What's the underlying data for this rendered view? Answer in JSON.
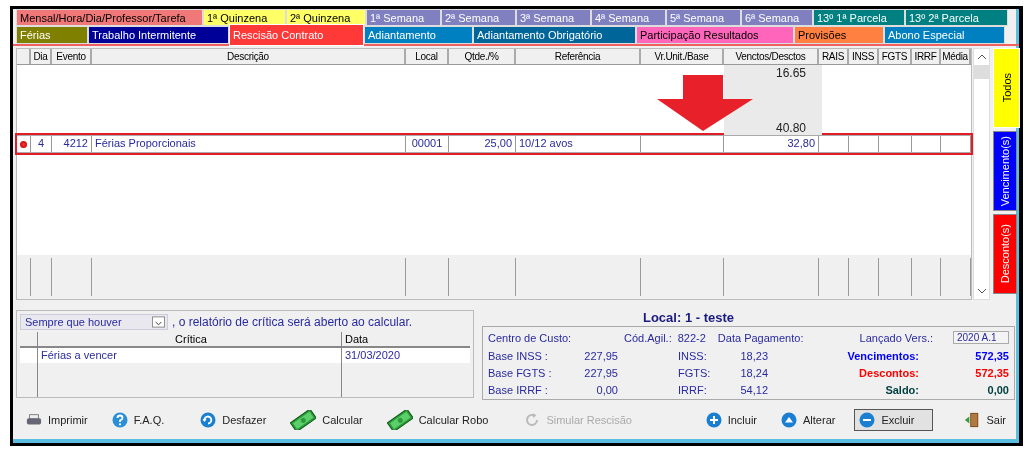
{
  "tabs_row_1": [
    {
      "label": "Mensal/Hora/Dia/Professor/Tarefa",
      "color": "#f07878",
      "selected": false
    },
    {
      "label": "1ª Quinzena",
      "color": "#ffff66",
      "selected": false
    },
    {
      "label": "2ª Quinzena",
      "color": "#ffff66",
      "selected": false
    },
    {
      "label": "1ª Semana",
      "color": "#8080c0",
      "selected": false
    },
    {
      "label": "2ª Semana",
      "color": "#8080c0",
      "selected": false
    },
    {
      "label": "3ª Semana",
      "color": "#8080c0",
      "selected": false
    },
    {
      "label": "4ª Semana",
      "color": "#8080c0",
      "selected": false
    },
    {
      "label": "5ª Semana",
      "color": "#8080c0",
      "selected": false
    },
    {
      "label": "6ª Semana",
      "color": "#8080c0",
      "selected": false
    },
    {
      "label": "13º  1ª Parcela",
      "color": "#008080",
      "selected": false
    },
    {
      "label": "13º  2ª  Parcela",
      "color": "#008080",
      "selected": false
    }
  ],
  "tabs_row_2": [
    {
      "label": "Férias",
      "color": "#808000",
      "selected": false
    },
    {
      "label": "Trabalho Intermitente",
      "color": "#000099",
      "selected": false
    },
    {
      "label": "Rescisão Contrato",
      "color": "#ff3838",
      "selected": true
    },
    {
      "label": "Adiantamento",
      "color": "#0080c0",
      "selected": false
    },
    {
      "label": "Adiantamento Obrigatório",
      "color": "#006699",
      "selected": false
    },
    {
      "label": "Participação Resultados",
      "color": "#ff66bb",
      "selected": false
    },
    {
      "label": "Provisões",
      "color": "#ff8040",
      "selected": false
    },
    {
      "label": "Abono Especial",
      "color": "#0080c0",
      "selected": false
    }
  ],
  "table": {
    "columns": [
      "Dia",
      "Evento",
      "Descrição",
      "Local",
      "Qtde./%",
      "Referência",
      "Vr.Unit./Base",
      "Venctos/Desctos",
      "RAIS",
      "INSS",
      "FGTS",
      "IRRF",
      "Média"
    ],
    "value_list": [
      "16.65",
      "40.80"
    ],
    "rows": [
      {
        "current": true,
        "highlighted": true,
        "dia": "4",
        "evento": "4212",
        "descricao": "Férias Proporcionais",
        "local": "00001",
        "qtde": "25,00",
        "referencia": "10/12 avos",
        "venctos": "32,80"
      }
    ]
  },
  "side_tabs": [
    {
      "label": "Todos",
      "color": "#ffff00",
      "selected": true
    },
    {
      "label": "Vencimento(s)",
      "color": "#0000ff",
      "selected": false
    },
    {
      "label": "Desconto(s)",
      "color": "#ff0000",
      "selected": false
    }
  ],
  "critica": {
    "mode": "Sempre que houver",
    "sentence": ", o relatório de crítica será aberto ao calcular.",
    "columns": [
      "Crítica",
      "Data"
    ],
    "rows": [
      {
        "critica": "Férias a vencer",
        "data": "31/03/2020"
      }
    ]
  },
  "local_title": "Local: 1 - teste",
  "summary": {
    "centro_label": "Centro de Custo:",
    "cod_label": "Cód.Agil.:",
    "cod_value": "822-2",
    "pagamento_label": "Data Pagamento:",
    "versao_label": "Lançado Vers.:",
    "versao_value": "2020 A.1",
    "bases": [
      {
        "label": "Base  INSS :",
        "value": "227,95"
      },
      {
        "label": "Base FGTS :",
        "value": "227,95"
      },
      {
        "label": "Base  IRRF :",
        "value": "0,00"
      }
    ],
    "taxes": [
      {
        "label": "INSS:",
        "value": "18,23"
      },
      {
        "label": "FGTS:",
        "value": "18,24"
      },
      {
        "label": "IRRF:",
        "value": "54,12"
      }
    ],
    "totals": [
      {
        "label": "Vencimentos:",
        "value": "572,35",
        "color": "#0000ff"
      },
      {
        "label": "Descontos:",
        "value": "572,35",
        "color": "#ff0000"
      },
      {
        "label": "Saldo:",
        "value": "0,00",
        "color": "#004040"
      }
    ]
  },
  "toolbar": [
    {
      "label": "Imprimir",
      "kind": "printer",
      "disabled": false,
      "default": false
    },
    {
      "label": "F.A.Q.",
      "kind": "help",
      "disabled": false,
      "default": false
    },
    {
      "label": "Desfazer",
      "kind": "undo",
      "disabled": false,
      "default": false
    },
    {
      "label": "Calcular",
      "kind": "money",
      "disabled": false,
      "default": false
    },
    {
      "label": "Calcular Robo",
      "kind": "money",
      "disabled": false,
      "default": false
    },
    {
      "label": "Simular Rescisão",
      "kind": "refresh",
      "disabled": true,
      "default": false
    },
    {
      "label": "Incluir",
      "kind": "plus",
      "disabled": false,
      "default": false
    },
    {
      "label": "Alterar",
      "kind": "up",
      "disabled": false,
      "default": false
    },
    {
      "label": "Excluir",
      "kind": "minus",
      "disabled": false,
      "default": true
    },
    {
      "label": "Sair",
      "kind": "exit",
      "disabled": false,
      "default": false
    }
  ]
}
